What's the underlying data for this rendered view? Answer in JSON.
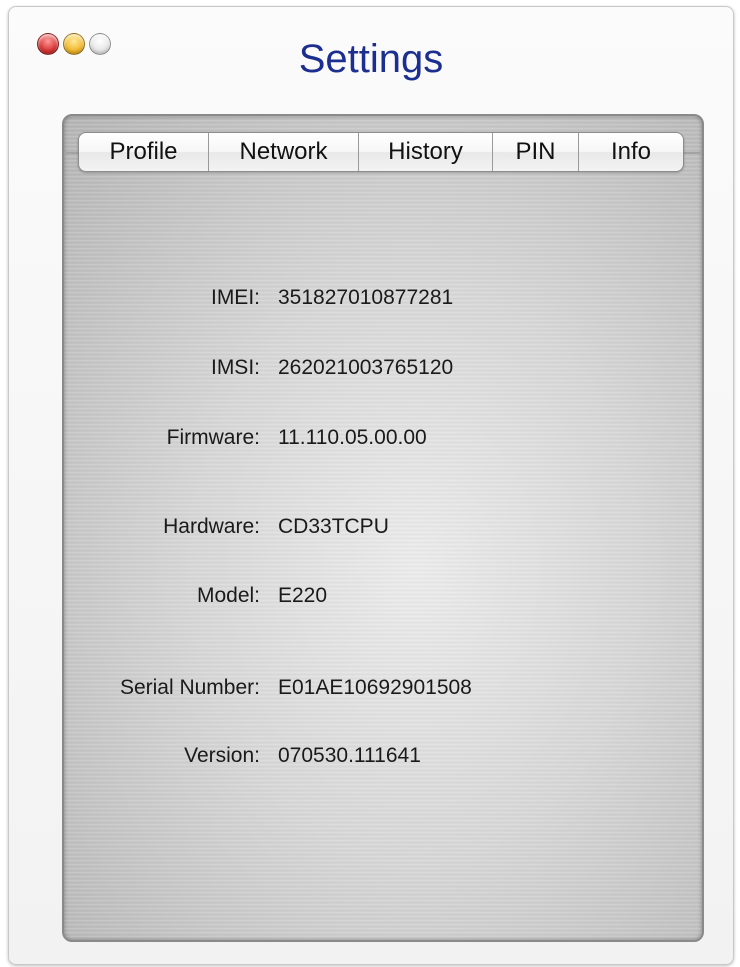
{
  "window": {
    "title": "Settings",
    "buttons": [
      "close-button",
      "minimize-button",
      "zoom-button"
    ]
  },
  "tabs": [
    {
      "label": "Profile"
    },
    {
      "label": "Network"
    },
    {
      "label": "History"
    },
    {
      "label": "PIN"
    },
    {
      "label": "Info",
      "selected": true
    }
  ],
  "info": {
    "rows": [
      {
        "label": "IMEI:",
        "value": "351827010877281"
      },
      {
        "label": "IMSI:",
        "value": "262021003765120"
      },
      {
        "label": "Firmware:",
        "value": "11.110.05.00.00"
      },
      {
        "label": "Hardware:",
        "value": "CD33TCPU"
      },
      {
        "label": "Model:",
        "value": "E220"
      },
      {
        "label": "Serial Number:",
        "value": "E01AE10692901508"
      },
      {
        "label": "Version:",
        "value": "070530.111641"
      }
    ]
  },
  "colors": {
    "title": "#1c2e8f",
    "close": "#d63434",
    "minimize": "#f1b82c",
    "zoom": "#e6e6e6"
  }
}
